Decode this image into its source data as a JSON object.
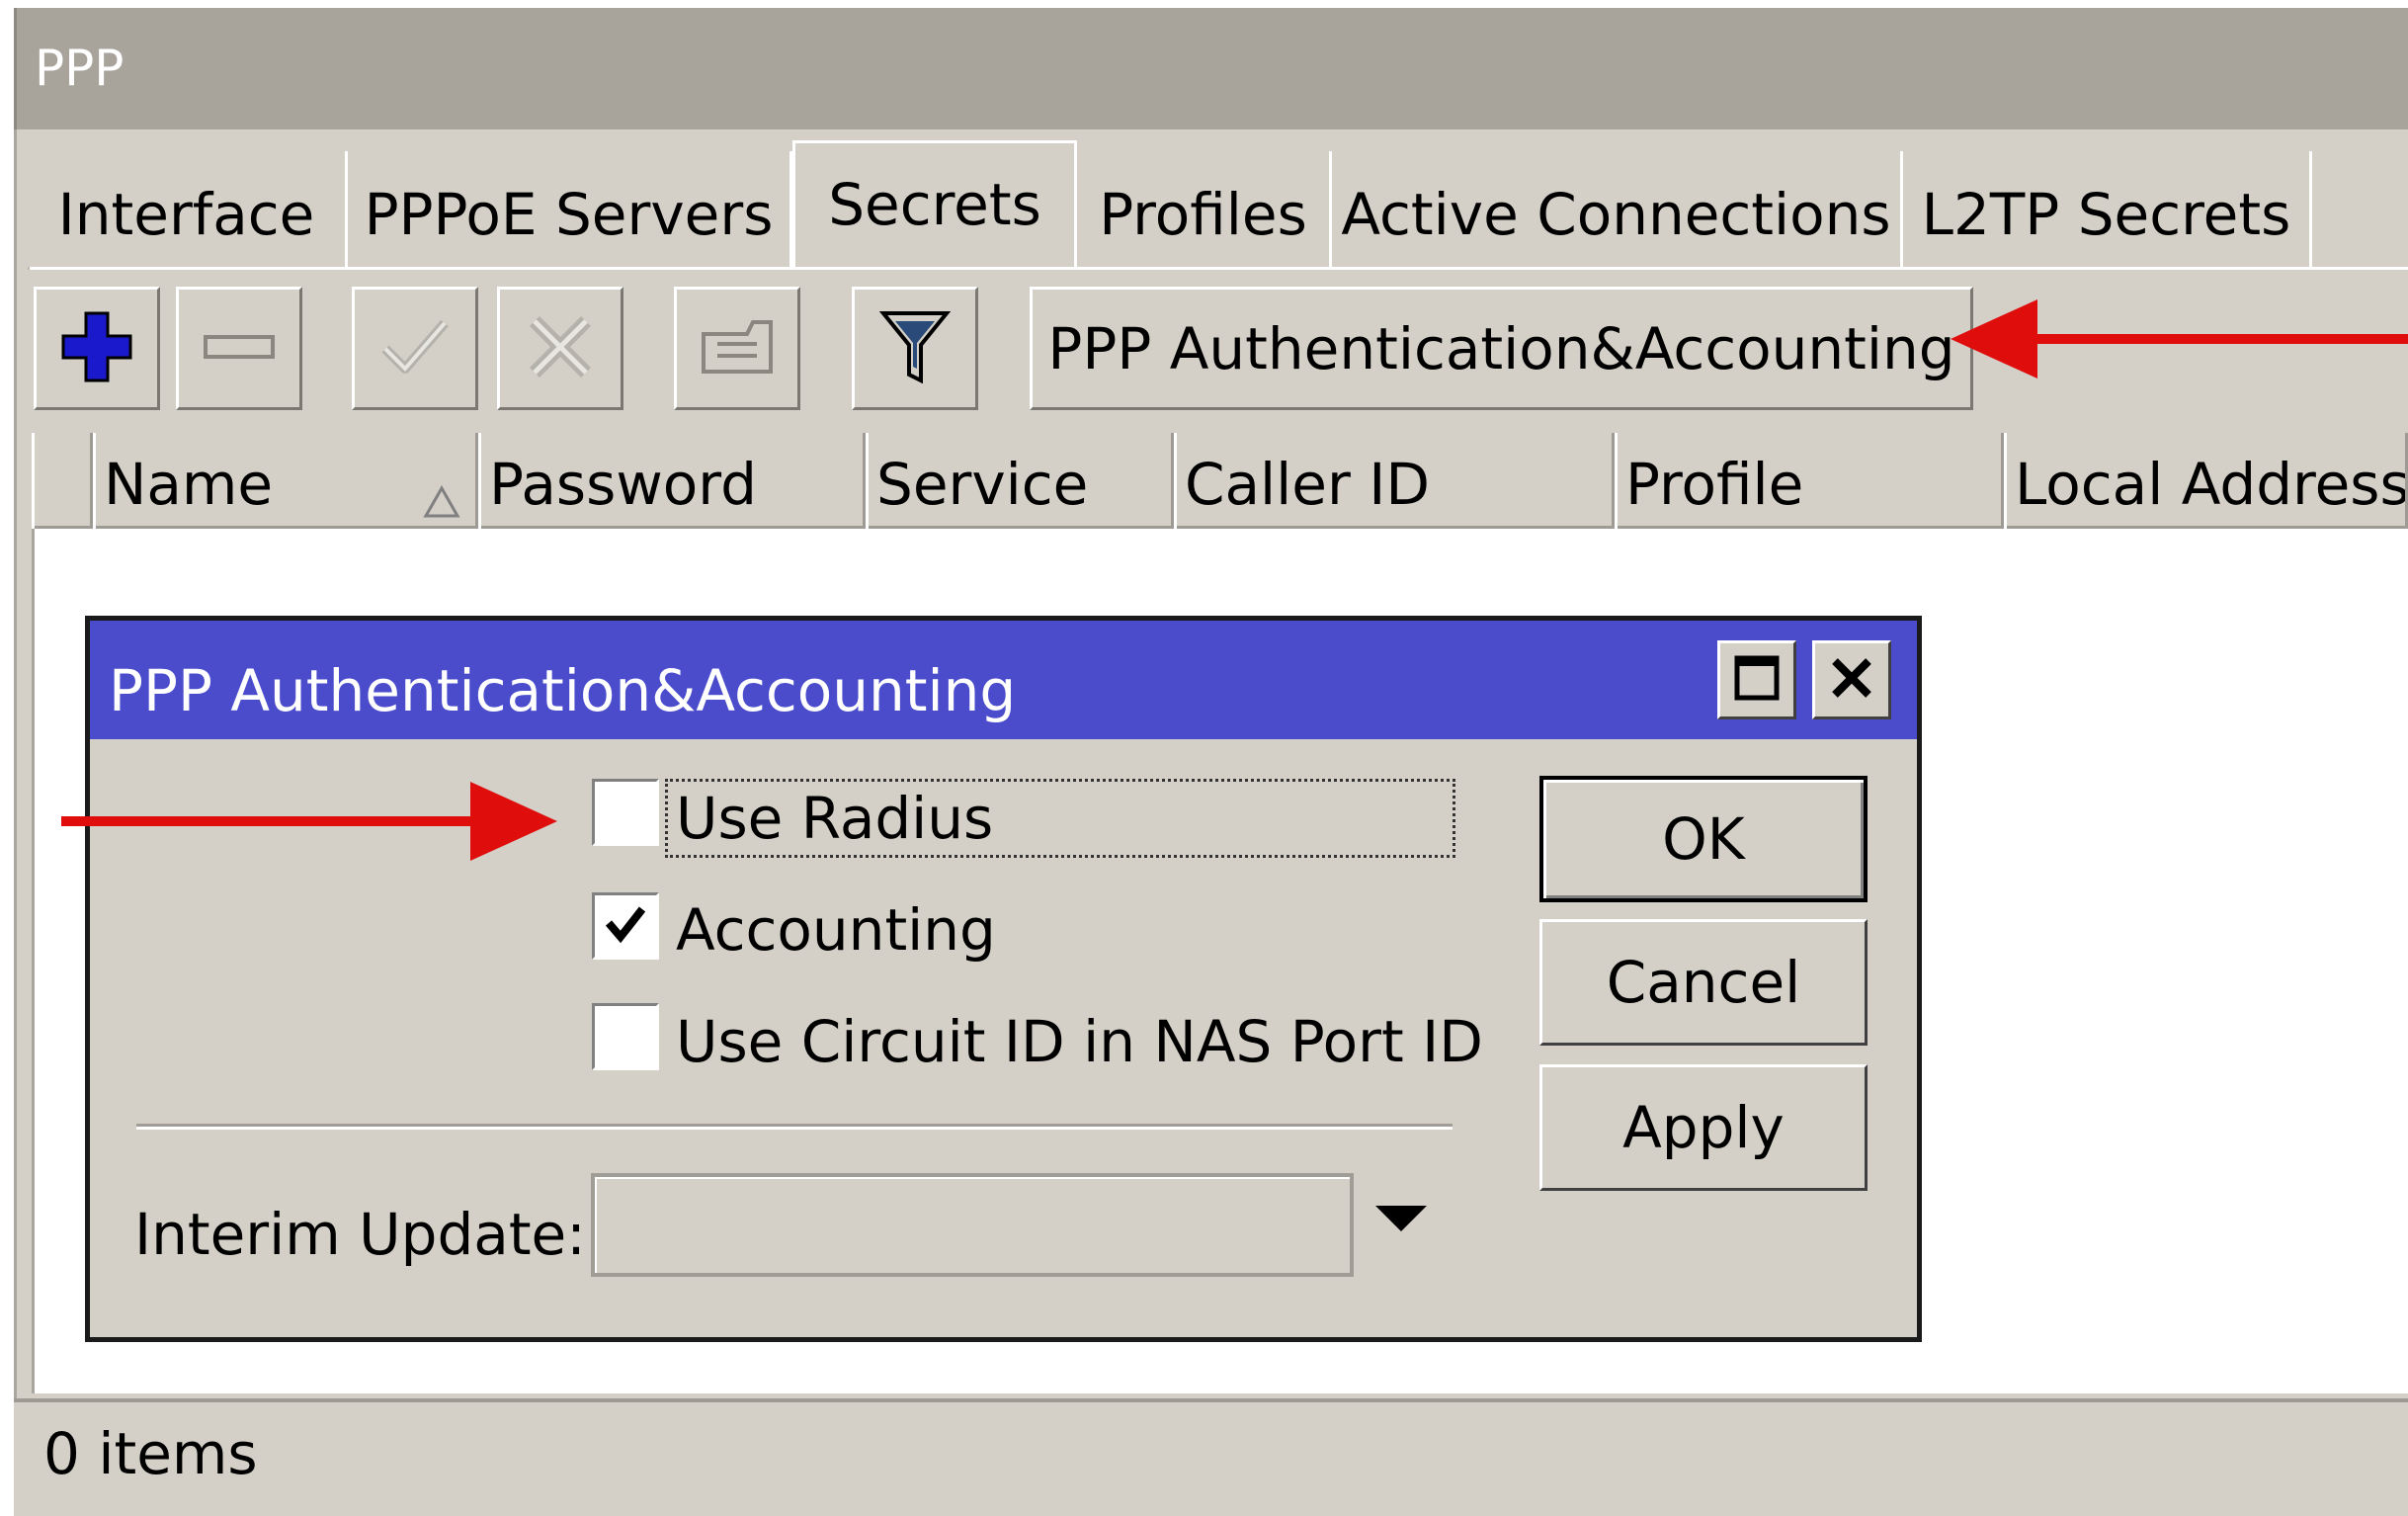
{
  "window": {
    "title": "PPP"
  },
  "tabs": [
    {
      "label": "Interface"
    },
    {
      "label": "PPPoE Servers"
    },
    {
      "label": "Secrets",
      "active": true
    },
    {
      "label": "Profiles"
    },
    {
      "label": "Active Connections"
    },
    {
      "label": "L2TP Secrets"
    }
  ],
  "toolbar": {
    "add_icon": "plus-icon",
    "remove_icon": "minus-icon",
    "enable_icon": "check-icon",
    "disable_icon": "x-icon",
    "comment_icon": "comment-icon",
    "filter_icon": "filter-icon",
    "auth_accounting_label": "PPP Authentication&Accounting"
  },
  "table": {
    "columns": [
      "Name",
      "Password",
      "Service",
      "Caller ID",
      "Profile",
      "Local Address"
    ],
    "sort_column": "Name",
    "sort_direction": "ascending",
    "rows": []
  },
  "status": {
    "text": "0 items"
  },
  "dialog": {
    "title": "PPP Authentication&Accounting",
    "checkboxes": [
      {
        "label": "Use Radius",
        "checked": false
      },
      {
        "label": "Accounting",
        "checked": true
      },
      {
        "label": "Use Circuit ID in NAS Port ID",
        "checked": false
      }
    ],
    "interim_update": {
      "label": "Interim Update:",
      "value": ""
    },
    "buttons": {
      "ok": "OK",
      "cancel": "Cancel",
      "apply": "Apply"
    }
  },
  "colors": {
    "dialog_title_bg": "#4a4ccc",
    "window_bg": "#d4d0c8",
    "annotation_arrow": "#e00d0d",
    "add_icon_color": "#1a1acc"
  }
}
